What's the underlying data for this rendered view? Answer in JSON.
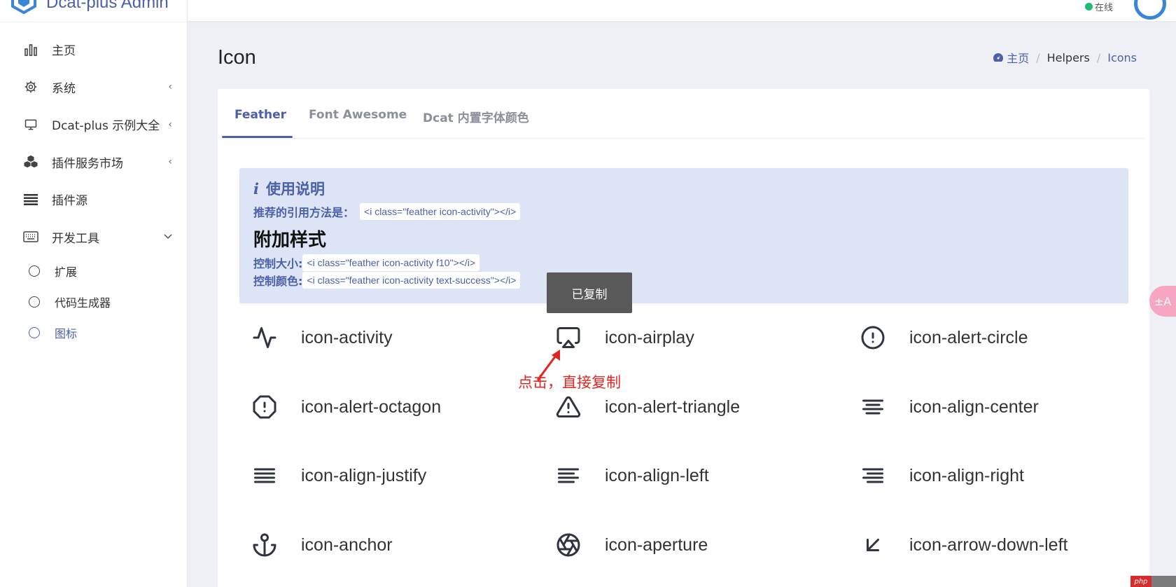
{
  "brand": {
    "name": "Dcat-plus Admin"
  },
  "topbar": {
    "online_label": "在线"
  },
  "sidebar": {
    "items": [
      {
        "label": "主页",
        "icon": "bar-chart-icon",
        "arrow": ""
      },
      {
        "label": "系统",
        "icon": "gear-icon",
        "arrow": "‹"
      },
      {
        "label": "Dcat-plus 示例大全",
        "icon": "monitor-icon",
        "arrow": "‹"
      },
      {
        "label": "插件服务市场",
        "icon": "cubes-icon",
        "arrow": "‹"
      },
      {
        "label": "插件源",
        "icon": "list-icon",
        "arrow": ""
      },
      {
        "label": "开发工具",
        "icon": "keyboard-icon",
        "arrow": "⌄"
      }
    ],
    "sub_items": [
      {
        "label": "扩展"
      },
      {
        "label": "代码生成器"
      },
      {
        "label": "图标"
      }
    ]
  },
  "page": {
    "title": "Icon",
    "breadcrumb": {
      "home": "主页",
      "mid": "Helpers",
      "current": "Icons",
      "sep": "/"
    }
  },
  "tabs": [
    {
      "label": "Feather"
    },
    {
      "label": "Font Awesome"
    },
    {
      "label": "Dcat 内置字体颜色"
    }
  ],
  "callout": {
    "title": "使用说明",
    "recommend_label": "推荐的引用方法是：",
    "recommend_code": "<i class=\"feather icon-activity\"></i>",
    "extra_title": "附加样式",
    "size_label": "控制大小:",
    "size_code": "<i class=\"feather icon-activity f10\"></i>",
    "color_label": "控制颜色:",
    "color_code": "<i class=\"feather icon-activity text-success\"></i>"
  },
  "tooltip": {
    "text": "已复制"
  },
  "annotation": {
    "text": "点击，直接复制"
  },
  "icons": [
    {
      "name": "icon-activity"
    },
    {
      "name": "icon-airplay"
    },
    {
      "name": "icon-alert-circle"
    },
    {
      "name": "icon-alert-octagon"
    },
    {
      "name": "icon-alert-triangle"
    },
    {
      "name": "icon-align-center"
    },
    {
      "name": "icon-align-justify"
    },
    {
      "name": "icon-align-left"
    },
    {
      "name": "icon-align-right"
    },
    {
      "name": "icon-anchor"
    },
    {
      "name": "icon-aperture"
    },
    {
      "name": "icon-arrow-down-left"
    }
  ],
  "float_button": {
    "text": "±A"
  },
  "watermark": {
    "text": "php"
  },
  "colors": {
    "accent": "#4c60a8",
    "online": "#21b978",
    "annotation": "#e52521",
    "callout_bg": "#dce4f5"
  }
}
